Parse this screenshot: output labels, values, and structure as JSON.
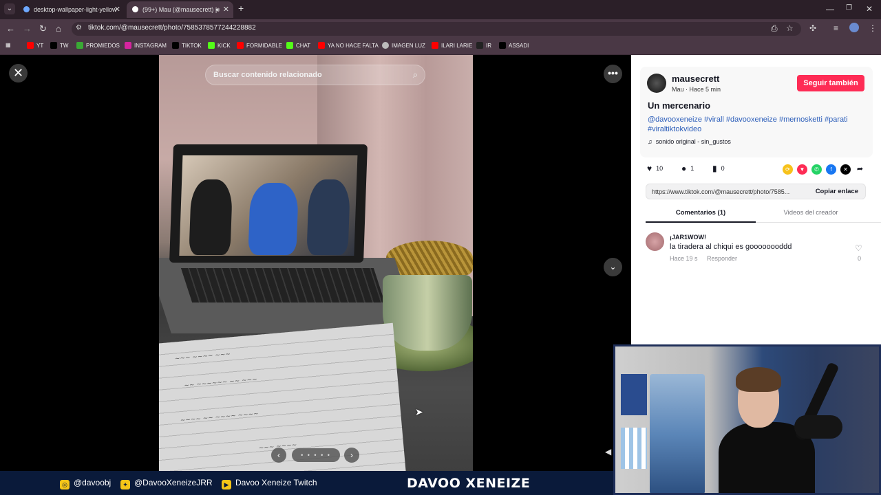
{
  "browser": {
    "tabs": [
      {
        "title": "desktop-wallpaper-light-yellow",
        "favicon_color": "#6ea8ff"
      },
      {
        "title": "(99+) Mau (@mausecrett) | ",
        "favicon_color": "#ffffff",
        "audio_icon": "speaker-icon"
      }
    ],
    "new_tab": "+",
    "window_controls": {
      "minimize": "—",
      "restore": "❐",
      "close": "✕"
    },
    "url": "tiktok.com/@mausecrett/photo/7585378577244228882",
    "bookmarks": [
      {
        "label": "YT",
        "color": "#ff0000"
      },
      {
        "label": "TW",
        "color": "#000000"
      },
      {
        "label": "PROMIEDOS",
        "color": "#3aa935"
      },
      {
        "label": "INSTAGRAM",
        "color": "#d6249f"
      },
      {
        "label": "TIKTOK",
        "color": "#000000"
      },
      {
        "label": "KICK",
        "color": "#53fc18"
      },
      {
        "label": "FORMIDABLE",
        "color": "#ff0000"
      },
      {
        "label": "CHAT",
        "color": "#53fc18"
      },
      {
        "label": "YA NO HACE FALTA",
        "color": "#ff0000"
      },
      {
        "label": "IMAGEN LUZ",
        "color": "#bbbbbb"
      },
      {
        "label": "ILARI LARIE",
        "color": "#ff0000"
      },
      {
        "label": "IR",
        "color": "#222222"
      },
      {
        "label": "ASSADI",
        "color": "#000000"
      }
    ]
  },
  "viewer": {
    "search_placeholder": "Buscar contenido relacionado",
    "close_label": "✕",
    "more_label": "•••",
    "down_label": "⌄",
    "carousel": {
      "prev": "‹",
      "next": "›",
      "dots": "• • • • •"
    }
  },
  "panel": {
    "username": "mausecrett",
    "meta": "Mau · Hace 5 min",
    "follow_label": "Seguir también",
    "title": "Un mercenario",
    "tags": "@davooxeneize #virall #davooxeneize #mernosketti #parati #viraltiktokvideo",
    "sound": "sonido original - sin_gustos",
    "likes": "10",
    "comments": "1",
    "saves": "0",
    "share_colors": [
      "#f7c21b",
      "#fe2c55",
      "#25d366",
      "#1877f2",
      "#000000"
    ],
    "link": "https://www.tiktok.com/@mausecrett/photo/7585...",
    "copy_label": "Copiar enlace",
    "tab_comments": "Comentarios (1)",
    "tab_videos": "Videos del creador",
    "comment": {
      "user": "¡JAR1WOW!",
      "text": "la tiradera al chiqui es goooooooddd",
      "time": "Hace 19 s",
      "reply": "Responder",
      "likes": "0"
    }
  },
  "streambar": {
    "instagram": "@davoobj",
    "twitter": "@DavooXeneizeJRR",
    "twitch": "Davoo Xeneize Twitch",
    "brand": "DAVOO XENEIZE"
  }
}
